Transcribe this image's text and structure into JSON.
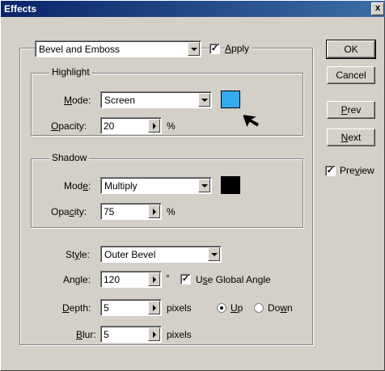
{
  "window": {
    "title": "Effects",
    "close": "x"
  },
  "effect_select": {
    "value": "Bevel and Emboss"
  },
  "apply": {
    "label_pre": "",
    "label_u": "A",
    "label_post": "pply",
    "checked_glyph": "✓"
  },
  "highlight": {
    "title": "Highlight",
    "mode_label": {
      "pre": "",
      "u": "M",
      "post": "ode:"
    },
    "mode_value": "Screen",
    "opacity_label": {
      "pre": "",
      "u": "O",
      "post": "pacity:"
    },
    "opacity_value": "20",
    "opacity_unit": "%",
    "color": "#33aaee"
  },
  "shadow": {
    "title": "Shadow",
    "mode_label": {
      "pre": "Mod",
      "u": "e",
      "post": ":"
    },
    "mode_value": "Multiply",
    "opacity_label": {
      "pre": "Opa",
      "u": "c",
      "post": "ity:"
    },
    "opacity_value": "75",
    "opacity_unit": "%",
    "color": "#000000"
  },
  "style": {
    "label_pre": "St",
    "label_u": "y",
    "label_post": "le:",
    "value": "Outer Bevel"
  },
  "angle": {
    "label": "Angle:",
    "value": "120",
    "unit": "°",
    "global_pre": "U",
    "global_u": "s",
    "global_post": "e Global Angle",
    "checked_glyph": "✓"
  },
  "depth": {
    "label_pre": "",
    "label_u": "D",
    "label_post": "epth:",
    "value": "5",
    "unit": "pixels",
    "up_pre": "",
    "up_u": "U",
    "up_post": "p",
    "down_pre": "Do",
    "down_u": "w",
    "down_post": "n"
  },
  "blur": {
    "label_pre": "",
    "label_u": "B",
    "label_post": "lur:",
    "value": "5",
    "unit": "pixels"
  },
  "buttons": {
    "ok": "OK",
    "cancel": "Cancel",
    "prev_u": "P",
    "prev_post": "rev",
    "next_u": "N",
    "next_post": "ext"
  },
  "preview": {
    "pre": "Pre",
    "u": "v",
    "post": "iew",
    "checked_glyph": "✓"
  }
}
